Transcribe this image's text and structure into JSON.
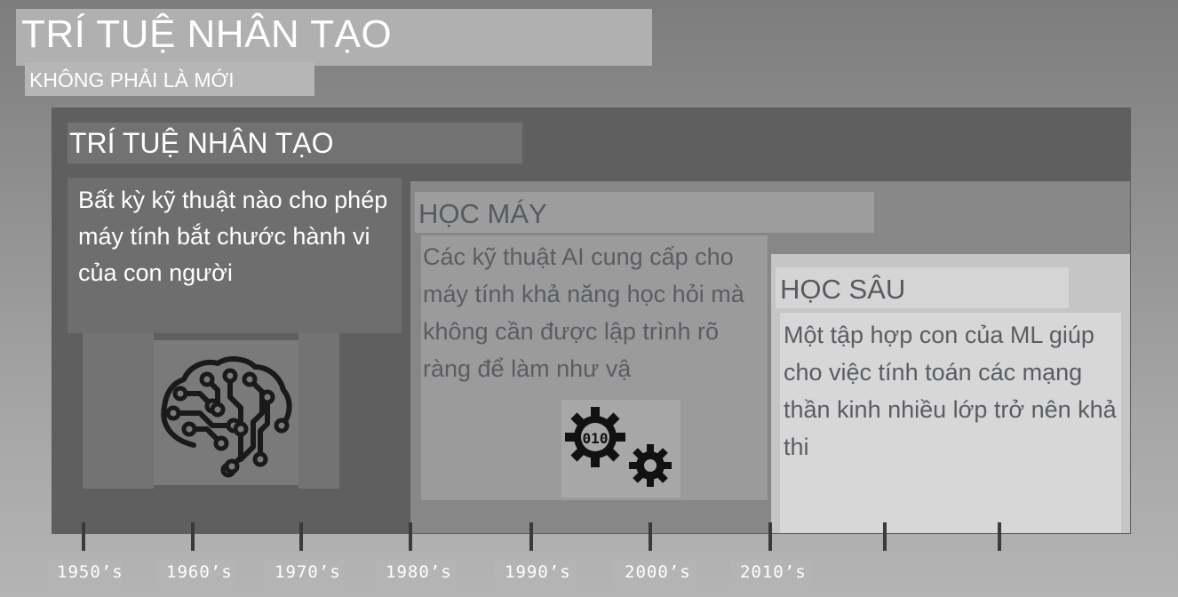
{
  "header": {
    "title": "TRÍ TUỆ NHÂN TẠO",
    "subtitle": "KHÔNG PHẢI LÀ MỚI"
  },
  "ai": {
    "title": "TRÍ TUỆ NHÂN TẠO",
    "description": "Bất kỳ kỹ thuật nào cho phép máy tính bắt chước hành vi của con người",
    "icon": "brain-circuit-icon"
  },
  "ml": {
    "title": "HỌC MÁY",
    "description": "Các kỹ thuật AI cung cấp cho máy tính khả năng học hỏi mà không cần được lập trình rõ ràng để làm như vậ",
    "icon": "gears-binary-icon"
  },
  "dl": {
    "title": "HỌC SÂU",
    "description": "Một tập hợp con của ML giúp cho việc tính toán các mạng thần kinh nhiều lớp trở nên khả thi"
  },
  "timeline": {
    "years": [
      "1950’s",
      "1960’s",
      "1970’s",
      "1980’s",
      "1990’s",
      "2000’s",
      "2010’s"
    ]
  },
  "colors": {
    "ai_panel": "#5f5f5f",
    "ml_panel": "#878787",
    "dl_panel": "#c5c5c5",
    "tick": "#3a3a3a"
  }
}
